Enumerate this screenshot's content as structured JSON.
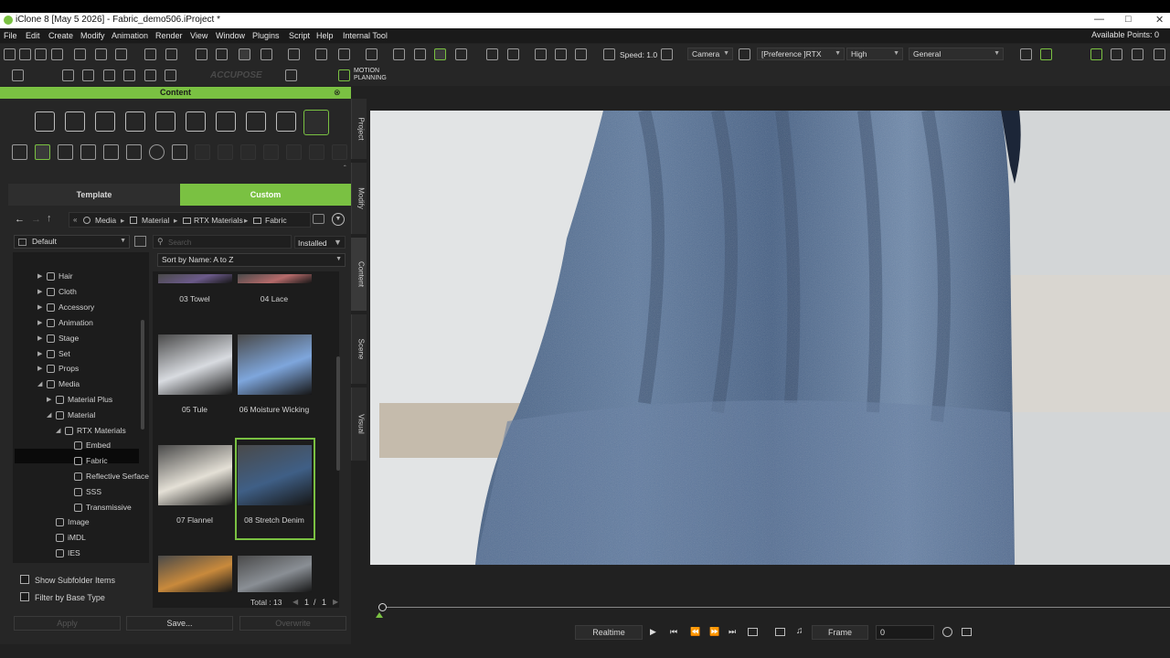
{
  "window": {
    "title": "iClone 8 [May  5 2026] - Fabric_demo506.iProject *"
  },
  "menu": [
    "File",
    "Edit",
    "Create",
    "Modify",
    "Animation",
    "Render",
    "View",
    "Window",
    "Plugins",
    "Script",
    "Help",
    "Internal Tool"
  ],
  "available_points": "Available Points: 0",
  "toolbar": {
    "speed": "Speed: 1.0",
    "camera": "Camera",
    "preference": "[Preference ]RTX",
    "quality": "High",
    "mode": "General",
    "accupose": "ACCUPOSE",
    "motion_planning_1": "MOTION",
    "motion_planning_2": "PLANNING"
  },
  "panel": {
    "title": "Content",
    "tab_template": "Template",
    "tab_custom": "Custom",
    "breadcrumb": [
      "Media",
      "Material",
      "RTX Materials",
      "Fabric"
    ],
    "filter": "Default",
    "search_placeholder": "Search",
    "installed": "Installed",
    "sort": "Sort by Name: A to Z",
    "tree": [
      {
        "label": "Hair"
      },
      {
        "label": "Cloth"
      },
      {
        "label": "Accessory"
      },
      {
        "label": "Animation"
      },
      {
        "label": "Stage"
      },
      {
        "label": "Set"
      },
      {
        "label": "Props"
      },
      {
        "label": "Media"
      },
      {
        "label": "Material Plus"
      },
      {
        "label": "Material"
      },
      {
        "label": "RTX Materials"
      },
      {
        "label": "Embed"
      },
      {
        "label": "Fabric"
      },
      {
        "label": "Reflective Serface"
      },
      {
        "label": "SSS"
      },
      {
        "label": "Transmissive"
      },
      {
        "label": "Image"
      },
      {
        "label": "iMDL"
      },
      {
        "label": "IES"
      }
    ],
    "items": [
      {
        "label": "03 Towel",
        "color": "#6b5a8a"
      },
      {
        "label": "04 Lace",
        "color": "#b56a6a"
      },
      {
        "label": "05 Tule",
        "color": "#d8dbe0"
      },
      {
        "label": "06 Moisture Wicking",
        "color": "#7ea6dc"
      },
      {
        "label": "07 Flannel",
        "color": "#e4e0d6"
      },
      {
        "label": "08 Stretch Denim",
        "color": "#3f5f86"
      },
      {
        "label": "",
        "color": "#c98a3c"
      },
      {
        "label": "",
        "color": "#8a8f95"
      }
    ],
    "show_subfolder": "Show Subfolder Items",
    "filter_base": "Filter by Base Type",
    "total": "Total : 13",
    "page": "1",
    "page_sep": "/",
    "page_total": "1",
    "apply": "Apply",
    "save": "Save...",
    "overwrite": "Overwrite"
  },
  "side_tabs": [
    "Project",
    "Modify",
    "Content",
    "Scene",
    "Visual"
  ],
  "playback": {
    "mode": "Realtime",
    "frame_label": "Frame",
    "frame_value": "0"
  },
  "colors": {
    "accent": "#7ac142",
    "cloth": "#4d6a91"
  }
}
